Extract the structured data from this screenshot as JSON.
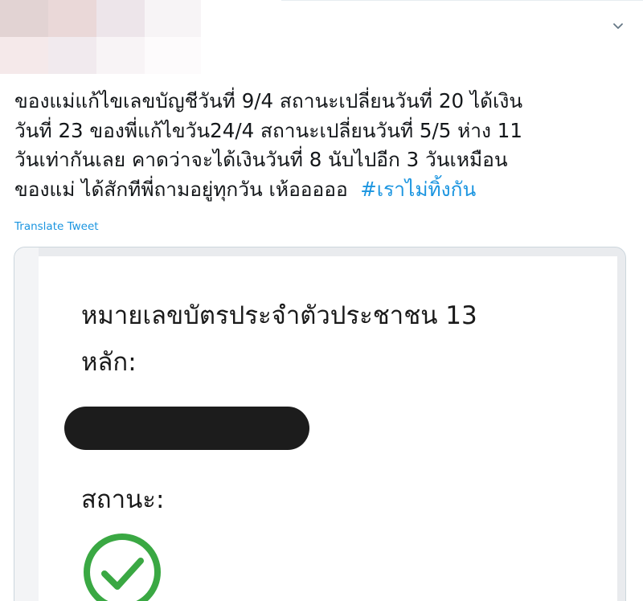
{
  "tweet": {
    "text_lines": [
      "ของแม่แก้ไขเลขบัญชีวันที่ 9/4 สถานะเปลี่ยนวันที่ 20 ได้เงิน",
      "วันที่ 23 ของพี่แก้ไขวัน24/4 สถานะเปลี่ยนวันที่ 5/5 ห่าง 11",
      "วันเท่ากันเลย คาดว่าจะได้เงินวันที่ 8 นับไปอีก 3 วันเหมือน",
      "ของแม่ ได้สักทีพี่ถามอยู่ทุกวัน เห้อออออ  "
    ],
    "hashtag": "#เราไม่ทิ้งกัน",
    "translate_label": "Translate Tweet",
    "menu_icon": "chevron-down-icon"
  },
  "card": {
    "id_label_lines": [
      "หมายเลขบัตรประจำตัวประชาชน 13",
      "หลัก:"
    ],
    "status_label": "สถานะ:",
    "status_icon": "check-circle-icon",
    "status_color": "#3aa843",
    "redaction_color": "#1c1c1c"
  },
  "colors": {
    "link": "#1b95e0",
    "text": "#14171a",
    "border": "#ccd6dd"
  }
}
